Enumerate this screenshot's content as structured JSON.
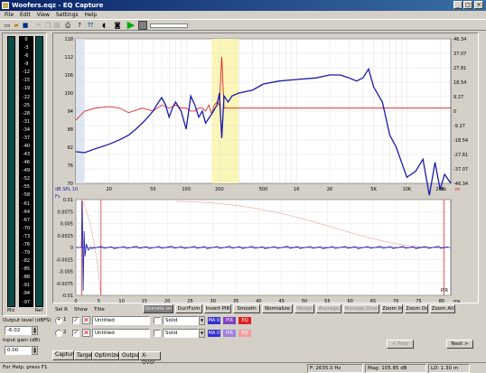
{
  "window": {
    "title": "Woofers.eqz - EQ Capture",
    "min": "_",
    "max": "□",
    "close": "×"
  },
  "menu": [
    "File",
    "Edit",
    "View",
    "Settings",
    "Help"
  ],
  "levels": {
    "scale": [
      "0",
      "4",
      "8",
      "12",
      "16",
      "20",
      "24",
      "28",
      "32",
      "36",
      "40",
      "44",
      "48",
      "52",
      "56",
      "60",
      "64",
      "68",
      "72",
      "76",
      "80",
      "84",
      "88",
      "92",
      "96",
      "97",
      "98",
      "99",
      "--",
      "95",
      "97",
      "98",
      "99"
    ],
    "labels": [
      "0",
      "-3",
      "-6",
      "-9",
      "-12",
      "-15",
      "-19",
      "-22",
      "-25",
      "-28",
      "-31",
      "-34",
      "-37",
      "-40",
      "-43",
      "-46",
      "-49",
      "-52",
      "-55",
      "-58",
      "-61",
      "-64",
      "-67",
      "-70",
      "-73",
      "-76",
      "-79",
      "-82",
      "-85",
      "-88",
      "-91",
      "-94",
      "-97"
    ],
    "left_label": "Mic",
    "right_label": "Ref",
    "output_label": "Output level (dBFS)",
    "output_value": "-6.02",
    "input_label": "Input gain (dB)",
    "input_value": "0.00"
  },
  "chart_data": [
    {
      "type": "line",
      "title": "",
      "ylabel_left": "",
      "yticks_left": [
        "118",
        "112",
        "106",
        "100",
        "94",
        "88",
        "82",
        "76",
        "70"
      ],
      "yticks_right": [
        "46.34",
        "37.07",
        "27.81",
        "18.54",
        "9.27",
        "0",
        "-9.27",
        "-18.54",
        "-27.81",
        "-37.07",
        "-46.34"
      ],
      "xticks": [
        "20",
        "50",
        "100",
        "200",
        "500",
        "1K",
        "2K",
        "5K",
        "10K",
        "20K"
      ],
      "x_corner_left": "dB SPL 10",
      "x_corner_right": "Hz",
      "x_unit_right": "m",
      "series": [
        {
          "color": "#1a1aa8",
          "x": [
            10,
            12,
            15,
            20,
            25,
            30,
            35,
            40,
            45,
            50,
            55,
            60,
            65,
            70,
            75,
            80,
            90,
            100,
            110,
            120,
            130,
            140,
            150,
            170,
            190,
            200,
            210,
            220,
            240,
            260,
            300,
            400,
            500,
            700,
            1000,
            1500,
            2000,
            2500,
            3000,
            3500,
            4000,
            4500,
            5000,
            6000,
            7000,
            8000,
            10000,
            12000,
            14000,
            16000,
            18000,
            20000,
            22000,
            25000
          ],
          "y": [
            80.5,
            80.2,
            81.5,
            83,
            84.5,
            86,
            88,
            90,
            92,
            94,
            96.5,
            98.5,
            96,
            92,
            95,
            97,
            94,
            88,
            99,
            96,
            92,
            94,
            90,
            93,
            96,
            100,
            85,
            99,
            97,
            99,
            100,
            101,
            103,
            104,
            104.5,
            105,
            106,
            106,
            105,
            104,
            105,
            108,
            102,
            97,
            86,
            82,
            72,
            74,
            78,
            66,
            77,
            68,
            73,
            70
          ]
        },
        {
          "color": "#e01010",
          "x": [
            10,
            12,
            15,
            20,
            25,
            30,
            40,
            50,
            60,
            70,
            80,
            90,
            100,
            110,
            120,
            130,
            140,
            150,
            160,
            170,
            180,
            190,
            200,
            210,
            220,
            230,
            240,
            250,
            300,
            500,
            1000,
            2000,
            5000,
            10000,
            25000
          ],
          "y": [
            91,
            94,
            95,
            95.5,
            95,
            93.5,
            95,
            94,
            96,
            95,
            96,
            95,
            95,
            94,
            94,
            95,
            95,
            94,
            96,
            93,
            96,
            97,
            96,
            112,
            95,
            95,
            95,
            95,
            95,
            95,
            95,
            95,
            95,
            95,
            95
          ]
        }
      ]
    },
    {
      "type": "line",
      "yticks": [
        "0.01",
        "0.0075",
        "0.005",
        "0.0025",
        "0",
        "-0.0025",
        "-0.005",
        "-0.0075",
        "-0.01"
      ],
      "xticks": [
        "0",
        "5",
        "10",
        "15",
        "20",
        "25",
        "30",
        "35",
        "40",
        "45",
        "50",
        "55",
        "60",
        "65",
        "70",
        "75",
        "80"
      ],
      "x_unit": "ms",
      "label": "PIR",
      "corner": "Fs"
    }
  ],
  "buttons": [
    "Operate on",
    "Dur/Fs/m",
    "Invert PIR",
    "Smooth",
    "Normalize",
    "Merge",
    "Average",
    "Manage Over",
    "Zoom In",
    "Zoom Out",
    "Zoom All"
  ],
  "list": {
    "headers": [
      "Sel R",
      "Show",
      "Title"
    ],
    "rows": [
      {
        "num": "1",
        "title": "Untitled",
        "style": "Solid",
        "tags": [
          "MA 0",
          "PIR",
          "EQ"
        ]
      },
      {
        "num": "2",
        "title": "Untitled",
        "style": "Solid",
        "tags": [
          "MA 0",
          "PIR",
          "EQ"
        ]
      }
    ]
  },
  "nav": {
    "prev": "< Prev",
    "next": "Next >"
  },
  "tabs": [
    "Capture",
    "Target",
    "Optimizer",
    "Output",
    "X-Over"
  ],
  "status": {
    "help": "For Help, press F1",
    "freq": "F: 2635.0 Hz",
    "mag": "Mag: 105.85 dB",
    "ld": "LD: 1.30 m"
  }
}
